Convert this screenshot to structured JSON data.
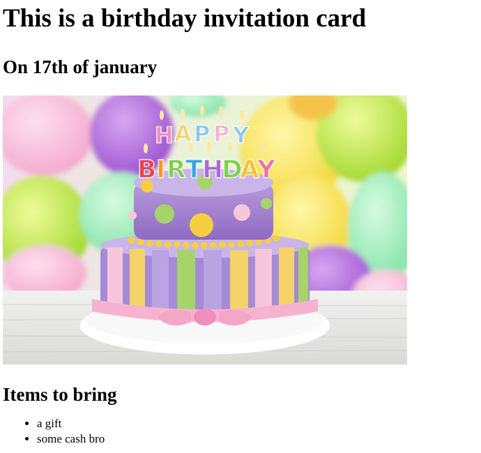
{
  "page": {
    "title": "This is a birthday invitation card",
    "subtitle": "On 17th of january"
  },
  "image": {
    "description_icon": "birthday-cake-photo",
    "cake_topper_top": "HAPPY",
    "cake_topper_bottom": "BIRTHDAY"
  },
  "items": {
    "heading": "Items to bring",
    "list": [
      "a gift",
      "some cash bro"
    ]
  }
}
